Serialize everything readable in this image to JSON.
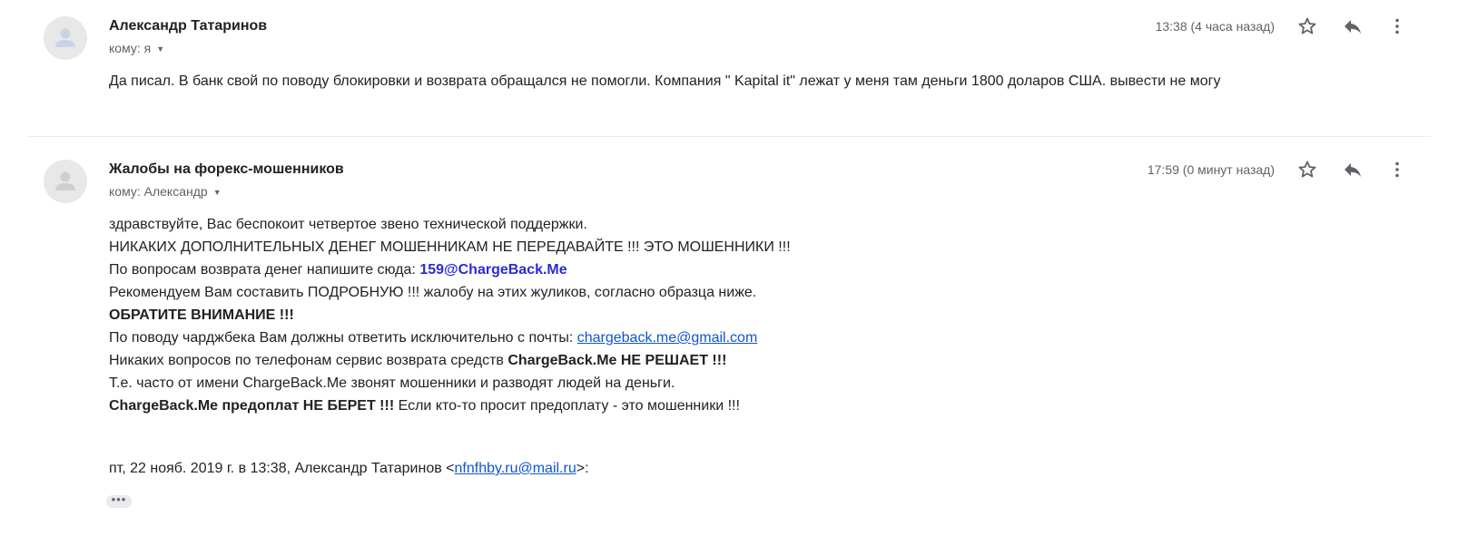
{
  "messages": [
    {
      "sender": "Александр Татаринов",
      "to_label": "кому: я",
      "time": "13:38 (4 часа назад)",
      "body": "Да писал.  В банк свой по поводу блокировки и возврата обращался не помогли. Компания \" Kapital it\" лежат у меня там деньги 1800 доларов США. вывести не могу"
    },
    {
      "sender": "Жалобы на форекс-мошенников",
      "to_label": "кому: Александр",
      "time": "17:59 (0 минут назад)",
      "lines": {
        "l1": "здравствуйте, Вас беспокоит четвертое звено технической поддержки.",
        "l2": "НИКАКИХ ДОПОЛНИТЕЛЬНЫХ ДЕНЕГ МОШЕННИКАМ НЕ ПЕРЕДАВАЙТЕ !!! ЭТО МОШЕННИКИ !!!",
        "l3_text": "По вопросам возврата денег напишите сюда: ",
        "l3_email": "159@ChargeBack.Me",
        "l4": "Рекомендуем Вам составить ПОДРОБНУЮ !!! жалобу на этих жуликов, согласно образца ниже.",
        "l5": "ОБРАТИТЕ ВНИМАНИЕ !!!",
        "l6_text": "По поводу чарджбека Вам должны ответить исключительно с почты: ",
        "l6_link": "chargeback.me@gmail.com",
        "l7_text": "Никаких вопросов по телефонам сервис возврата средств ",
        "l7_bold": "ChargeBack.Me НЕ РЕШАЕТ !!!",
        "l8": "Т.е. часто от имени ChargeBack.Me звонят мошенники и разводят людей на деньги.",
        "l9_bold": "ChargeBack.Me предоплат НЕ БЕРЕТ !!!",
        "l9_text": " Если кто-то просит предоплату - это мошенники !!!"
      },
      "quote_prefix": "пт, 22 нояб. 2019 г. в 13:38, Александр Татаринов <",
      "quote_email": "nfnfhby.ru@mail.ru",
      "quote_suffix": ">:",
      "ellipsis": "•••"
    }
  ],
  "icons": [
    "avatar-placeholder",
    "chevron-down-icon",
    "star-icon",
    "reply-icon",
    "more-vert-icon"
  ]
}
